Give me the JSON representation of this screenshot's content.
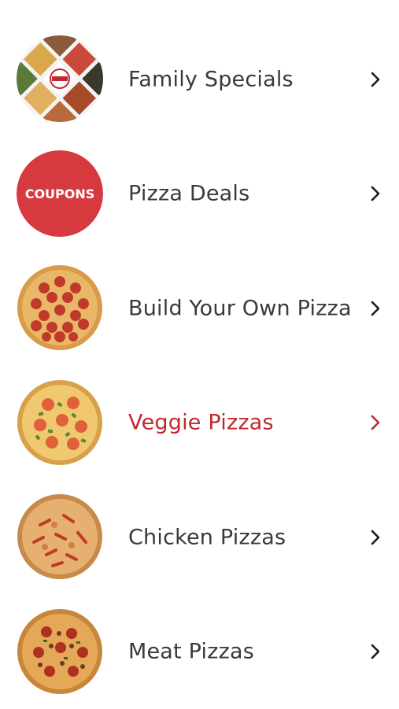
{
  "menu": {
    "items": [
      {
        "label": "Family Specials",
        "icon": "family-specials-collage-icon",
        "active": false
      },
      {
        "label": "Pizza Deals",
        "icon": "coupons-badge-icon",
        "badge_text": "COUPONS",
        "active": false
      },
      {
        "label": "Build Your Own Pizza",
        "icon": "pepperoni-pizza-icon",
        "active": false
      },
      {
        "label": "Veggie Pizzas",
        "icon": "veggie-pizza-icon",
        "active": true
      },
      {
        "label": "Chicken Pizzas",
        "icon": "chicken-pizza-icon",
        "active": false
      },
      {
        "label": "Meat Pizzas",
        "icon": "meat-pizza-icon",
        "active": false
      }
    ]
  },
  "colors": {
    "text": "#3a3a3a",
    "active": "#c0282f",
    "coupon_bg": "#d63a3e",
    "chevron": "#1a1a1a"
  }
}
